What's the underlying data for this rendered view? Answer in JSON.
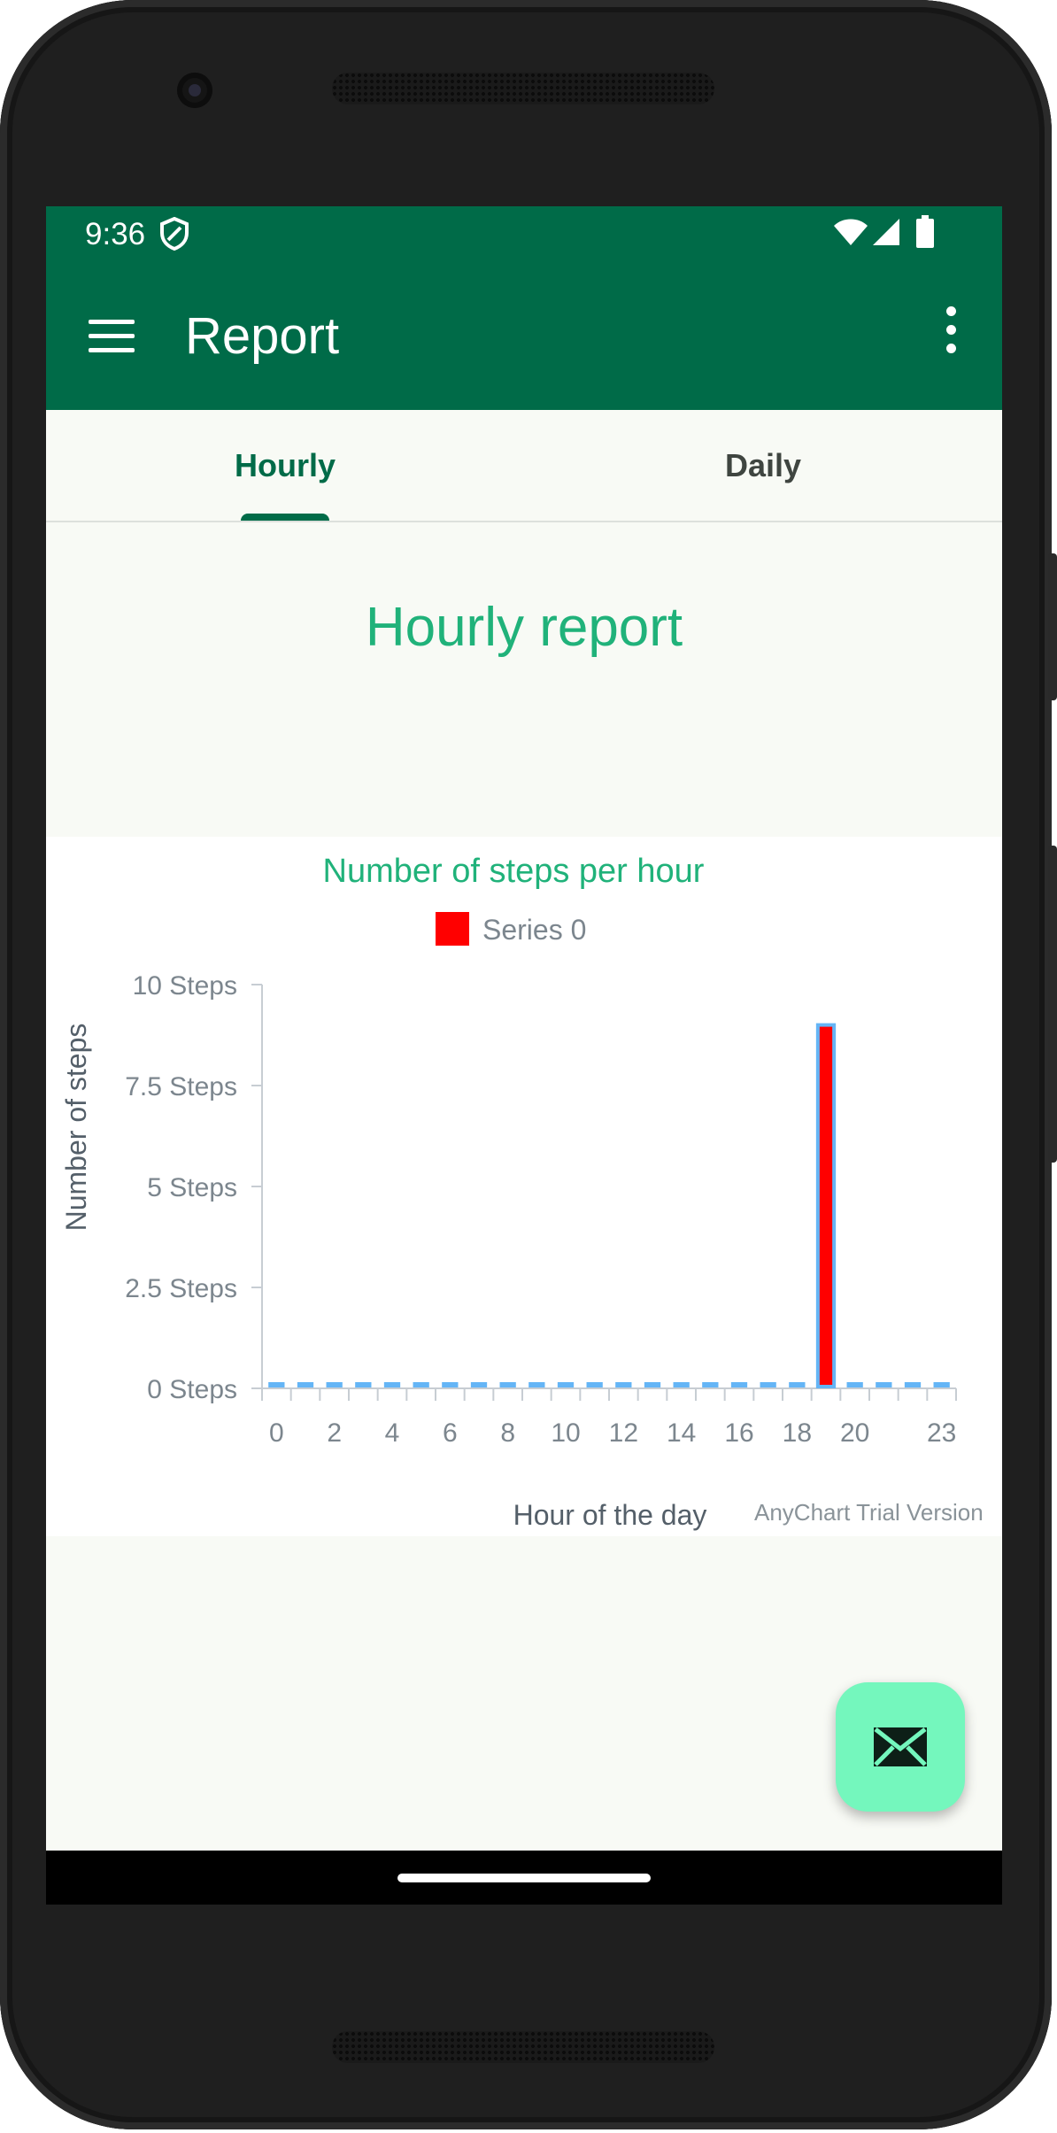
{
  "status_bar": {
    "time": "9:36",
    "icons": [
      "shield-icon",
      "wifi-icon",
      "signal-icon",
      "battery-icon"
    ]
  },
  "app_bar": {
    "title": "Report",
    "menu_icon": "menu-icon",
    "overflow_icon": "more-vert-icon"
  },
  "tabs": [
    {
      "label": "Hourly",
      "selected": true
    },
    {
      "label": "Daily",
      "selected": false
    }
  ],
  "page": {
    "heading": "Hourly report"
  },
  "chart_data": {
    "type": "bar",
    "title": "Number of steps per hour",
    "xlabel": "Hour of the day",
    "ylabel": "Number of steps",
    "legend": {
      "position": "top-center"
    },
    "series": [
      {
        "name": "Series 0",
        "color": "#ff0000",
        "x": [
          0,
          1,
          2,
          3,
          4,
          5,
          6,
          7,
          8,
          9,
          10,
          11,
          12,
          13,
          14,
          15,
          16,
          17,
          18,
          19,
          20,
          21,
          22,
          23
        ],
        "values": [
          0,
          0,
          0,
          0,
          0,
          0,
          0,
          0,
          0,
          0,
          0,
          0,
          0,
          0,
          0,
          0,
          0,
          0,
          0,
          9,
          0,
          0,
          0,
          0
        ]
      }
    ],
    "x_tick_labels": [
      "0",
      "2",
      "4",
      "6",
      "8",
      "10",
      "12",
      "14",
      "16",
      "18",
      "20",
      "23"
    ],
    "y_ticks": [
      0,
      2.5,
      5,
      7.5,
      10
    ],
    "y_tick_labels": [
      "0 Steps",
      "2.5 Steps",
      "5 Steps",
      "7.5 Steps",
      "10 Steps"
    ],
    "ylim": [
      0,
      10
    ],
    "xlim": [
      0,
      23
    ],
    "grid": false,
    "watermark": "AnyChart Trial Version",
    "colors": {
      "title": "#20b27a",
      "bar_fill": "#ff0000",
      "bar_stroke": "#64b5f6",
      "axis": "#c7cdd3",
      "text": "#7c868e",
      "axis_title": "#545f69"
    }
  },
  "fab": {
    "icon": "mail-icon"
  },
  "colors": {
    "primary": "#006b48",
    "accent": "#74f7bd",
    "heading": "#20b27a",
    "background": "#f8faf5"
  }
}
